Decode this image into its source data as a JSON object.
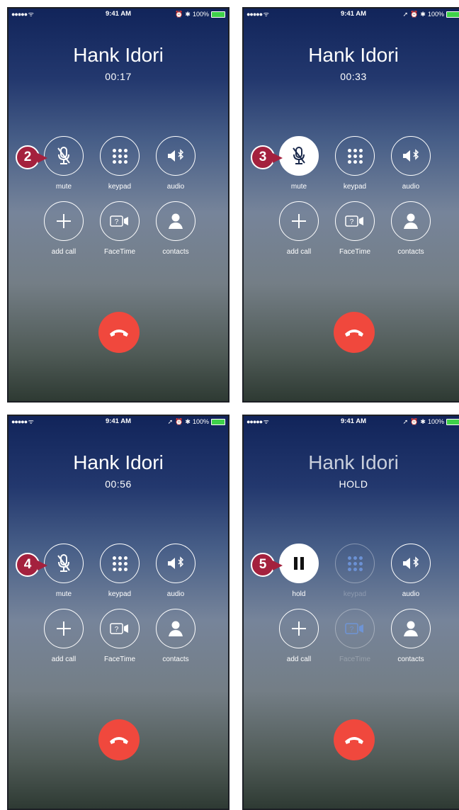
{
  "status": {
    "signal": "●●●●● ᯤ",
    "time": "9:41 AM",
    "battery": "100%"
  },
  "labels": {
    "mute": "mute",
    "keypad": "keypad",
    "audio": "audio",
    "add_call": "add call",
    "facetime": "FaceTime",
    "contacts": "contacts",
    "hold": "hold"
  },
  "screens": [
    {
      "caller": "Hank Idori",
      "timer": "00:17",
      "step": "2"
    },
    {
      "caller": "Hank Idori",
      "timer": "00:33",
      "step": "3"
    },
    {
      "caller": "Hank Idori",
      "timer": "00:56",
      "step": "4"
    },
    {
      "caller": "Hank Idori",
      "timer": "HOLD",
      "step": "5"
    }
  ],
  "colors": {
    "end_call": "#f0483d",
    "badge": "#a4213e",
    "battery": "#3fd24a"
  },
  "icons": [
    "microphone-muted-icon",
    "keypad-icon",
    "speaker-bluetooth-icon",
    "plus-icon",
    "facetime-icon",
    "contact-icon",
    "end-call-icon",
    "pause-icon"
  ]
}
